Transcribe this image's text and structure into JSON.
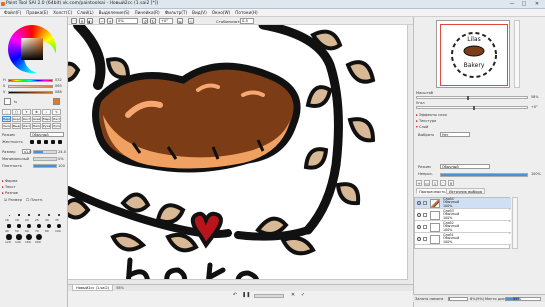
{
  "window": {
    "title": "Paint Tool SAI 2.0 (64bit) vk.com/paintoolsai - Новый2cc (1.sai2 [*])",
    "min_label": "—",
    "max_label": "□",
    "close_label": "✕"
  },
  "menu": [
    "Файл(F)",
    "Правка(E)",
    "Холст(C)",
    "Слой(L)",
    "Выделение(S)",
    "Линейка(R)",
    "Фильтр(T)",
    "Вид(V)",
    "Окно(W)",
    "Потоки(H)"
  ],
  "toolbar": {
    "zoom_value": "0%",
    "angle_value": "+0°",
    "stabilizer_label": "Стабилизатор",
    "stabilizer_value": "S-5"
  },
  "colors": {
    "accent": "#4a90d9",
    "primary_swatch": "#e07a2a",
    "secondary_swatch": "#ffffff"
  },
  "left": {
    "sliders": [
      {
        "label": "H",
        "value": "032"
      },
      {
        "label": "S",
        "value": "065"
      },
      {
        "label": "V",
        "value": "088"
      }
    ],
    "tools": [
      "Перо",
      "Аэрограф",
      "Кисть",
      "Акварель",
      "Маркер",
      "Ластик",
      "Заливка",
      "Выдел.",
      "Ластик В.",
      "Пипетка",
      "Рука",
      "Лупа"
    ],
    "mode_label": "Режим",
    "mode_value": "Обычный",
    "hardness_label": "Жесткость",
    "size_label": "Размер",
    "size_value": "x1.0",
    "size_num": "24.0",
    "min_size_label": "Минимальный",
    "min_size_value": "0%",
    "density_label": "Плотность",
    "density_value": "100",
    "sections": [
      "Форма",
      "Текст",
      "Разное"
    ],
    "footer_label_1": "Размер",
    "footer_label_2": "Плотн.",
    "brush_sizes": [
      "16",
      "18",
      "20",
      "25",
      "30",
      "35",
      "40",
      "50",
      "60",
      "70",
      "80",
      "100",
      "120",
      "140",
      "160",
      "200"
    ]
  },
  "canvas": {
    "doc_tab": "Новый2cc (1.sai2)",
    "doc_zoom": "58%"
  },
  "right": {
    "navigator_text_1": "Lilas",
    "navigator_text_2": "Bakery",
    "zoom_label": "Масштаб",
    "zoom_value": "58%",
    "angle_label": "Угол",
    "angle_value": "+0°",
    "effects_label": "Эффекты слоя",
    "texture_label": "Текстура",
    "layer_prop_label": "Слой",
    "choose_label": "Выбрать",
    "choose_value": "Нет",
    "mode_label": "Режим",
    "mode_value": "Обычный",
    "opacity_label": "Непроз.",
    "opacity_value": "100%",
    "tabs": [
      "Прозрачность",
      "Источник выбора"
    ],
    "layers": [
      {
        "name": "Слой4",
        "mode": "Обычный",
        "opacity": "100%"
      },
      {
        "name": "Слой3",
        "mode": "Обычный",
        "opacity": "100%"
      },
      {
        "name": "Слой2",
        "mode": "Обычный",
        "opacity": "100%"
      },
      {
        "name": "Слой1",
        "mode": "Обычный",
        "opacity": "100%"
      }
    ]
  },
  "status": {
    "memory_label": "Занято памяти",
    "memory_value": "8%(9%)",
    "memory_percent": 8,
    "disk_label": "Место диска",
    "disk_value": "37%",
    "disk_percent": 37
  }
}
